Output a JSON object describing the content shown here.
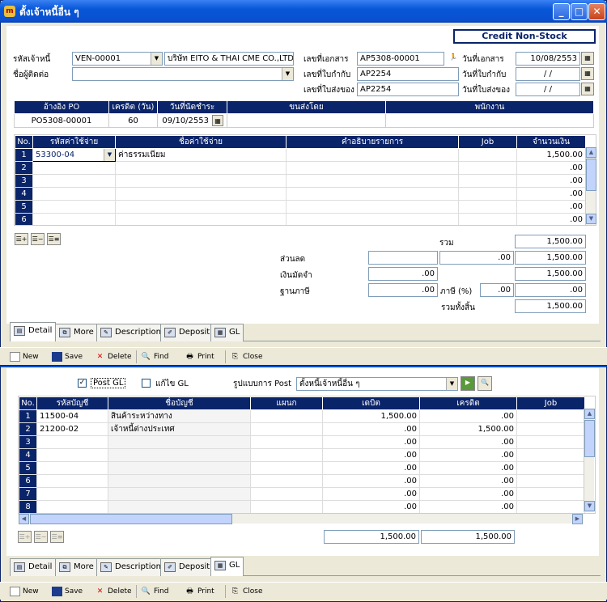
{
  "window": {
    "title": "ตั้งเจ้าหนี้อื่น ๆ",
    "app_icon_glyph": "m"
  },
  "header": {
    "mode": "Credit  Non-Stock",
    "vendor_code_label": "รหัสเจ้าหนี้",
    "vendor_code": "VEN-00001",
    "vendor_name": "บริษัท EITO & THAI CME CO.,LTD.",
    "contact_label": "ชื่อผู้ติดต่อ",
    "contact": "",
    "doc_no_label": "เลขที่เอกสาร",
    "doc_no": "AP5308-00001",
    "doc_date_label": "วันที่เอกสาร",
    "doc_date": "10/08/2553",
    "inv_no_label": "เลขที่ใบกำกับ",
    "inv_no": "AP2254",
    "inv_date_label": "วันที่ใบกำกับ",
    "inv_date": " / /",
    "dlv_no_label": "เลขที่ใบส่งของ",
    "dlv_no": "AP2254",
    "dlv_date_label": "วันที่ใบส่งของ",
    "dlv_date": " / /"
  },
  "po_table": {
    "headers": [
      "อ้างอิง PO",
      "เครดิต (วัน)",
      "วันที่นัดชำระ",
      "ขนส่งโดย",
      "พนักงาน"
    ],
    "row": [
      "PO5308-00001",
      "60",
      "09/10/2553",
      "",
      ""
    ]
  },
  "detail_table": {
    "headers": [
      "No.",
      "รหัสค่าใช้จ่าย",
      "ชื่อค่าใช้จ่าย",
      "คำอธิบายรายการ",
      "Job",
      "จำนวนเงิน"
    ],
    "rows": [
      {
        "no": "1",
        "code": "53300-04",
        "name": "ค่าธรรมเนียม",
        "desc": "",
        "job": "",
        "amount": "1,500.00"
      },
      {
        "no": "2",
        "code": "",
        "name": "",
        "desc": "",
        "job": "",
        "amount": ".00"
      },
      {
        "no": "3",
        "code": "",
        "name": "",
        "desc": "",
        "job": "",
        "amount": ".00"
      },
      {
        "no": "4",
        "code": "",
        "name": "",
        "desc": "",
        "job": "",
        "amount": ".00"
      },
      {
        "no": "5",
        "code": "",
        "name": "",
        "desc": "",
        "job": "",
        "amount": ".00"
      },
      {
        "no": "6",
        "code": "",
        "name": "",
        "desc": "",
        "job": "",
        "amount": ".00"
      }
    ]
  },
  "totals": {
    "sum_label": "รวม",
    "sum": "1,500.00",
    "discount_label": "ส่วนลด",
    "discount_a": "",
    "discount_b": ".00",
    "discount_total": "1,500.00",
    "deposit_label": "เงินมัดจำ",
    "deposit": ".00",
    "deposit_total": "1,500.00",
    "tax_base_label": "ฐานภาษี",
    "tax_base": ".00",
    "tax_label": "ภาษี (%)",
    "tax_rate": ".00",
    "tax_amount": ".00",
    "grand_label": "รวมทั้งสิ้น",
    "grand": "1,500.00"
  },
  "tabs": [
    "Detail",
    "More",
    "Description",
    "Deposit",
    "GL"
  ],
  "toolbar": [
    "New",
    "Save",
    "Delete",
    "Find",
    "Print",
    "Close"
  ],
  "gl": {
    "post_gl_label": "Post GL",
    "post_gl_checked": true,
    "edit_gl_label": "แก้ไข GL",
    "edit_gl_checked": false,
    "post_format_label": "รูปแบบการ Post",
    "post_format": "ตั้งหนี้เจ้าหนี้อื่น ๆ",
    "headers": [
      "No.",
      "รหัสบัญชี",
      "ชื่อบัญชี",
      "แผนก",
      "เดบิต",
      "เครดิต",
      "Job"
    ],
    "rows": [
      {
        "no": "1",
        "code": "11500-04",
        "name": "สินค้าระหว่างทาง",
        "dept": "",
        "debit": "1,500.00",
        "credit": ".00"
      },
      {
        "no": "2",
        "code": "21200-02",
        "name": "เจ้าหนี้ต่างประเทศ",
        "dept": "",
        "debit": ".00",
        "credit": "1,500.00"
      },
      {
        "no": "3",
        "code": "",
        "name": "",
        "dept": "",
        "debit": ".00",
        "credit": ".00"
      },
      {
        "no": "4",
        "code": "",
        "name": "",
        "dept": "",
        "debit": ".00",
        "credit": ".00"
      },
      {
        "no": "5",
        "code": "",
        "name": "",
        "dept": "",
        "debit": ".00",
        "credit": ".00"
      },
      {
        "no": "6",
        "code": "",
        "name": "",
        "dept": "",
        "debit": ".00",
        "credit": ".00"
      },
      {
        "no": "7",
        "code": "",
        "name": "",
        "dept": "",
        "debit": ".00",
        "credit": ".00"
      },
      {
        "no": "8",
        "code": "",
        "name": "",
        "dept": "",
        "debit": ".00",
        "credit": ".00"
      }
    ],
    "total_debit": "1,500.00",
    "total_credit": "1,500.00"
  }
}
